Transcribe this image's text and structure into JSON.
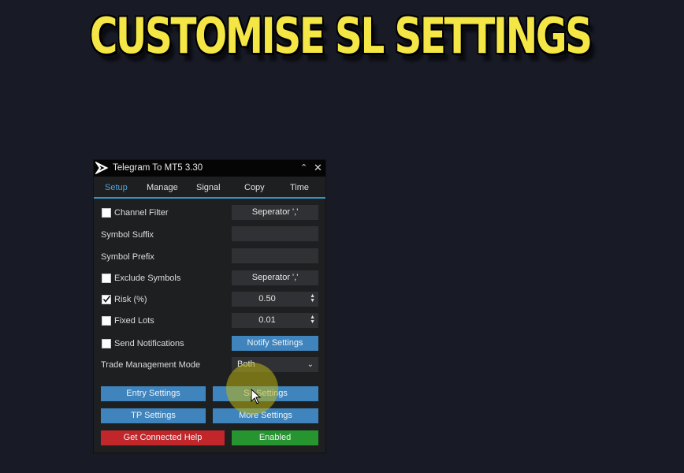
{
  "headline": "CUSTOMISE SL SETTINGS",
  "window": {
    "title": "Telegram To MT5 3.30",
    "minimize_icon": "chevron-up-icon",
    "close_icon": "close-icon"
  },
  "tabs": [
    {
      "label": "Setup",
      "active": true
    },
    {
      "label": "Manage",
      "active": false
    },
    {
      "label": "Signal",
      "active": false
    },
    {
      "label": "Copy",
      "active": false
    },
    {
      "label": "Time",
      "active": false
    }
  ],
  "settings": {
    "channel_filter": {
      "label": "Channel Filter",
      "checked": false,
      "button": "Seperator ','"
    },
    "symbol_suffix": {
      "label": "Symbol Suffix",
      "value": ""
    },
    "symbol_prefix": {
      "label": "Symbol Prefix",
      "value": ""
    },
    "exclude_symbols": {
      "label": "Exclude Symbols",
      "checked": false,
      "button": "Seperator ','"
    },
    "risk": {
      "label": "Risk (%)",
      "checked": true,
      "value": "0.50"
    },
    "fixed_lots": {
      "label": "Fixed Lots",
      "checked": false,
      "value": "0.01"
    },
    "send_notifications": {
      "label": "Send Notifications",
      "checked": false,
      "button": "Notify Settings"
    },
    "trade_management_mode": {
      "label": "Trade Management Mode",
      "value": "Both"
    }
  },
  "buttons": {
    "entry_settings": "Entry Settings",
    "sl_settings": "SL Settings",
    "tp_settings": "TP Settings",
    "more_settings": "More Settings",
    "get_connected_help": "Get Connected Help",
    "enabled": "Enabled"
  },
  "colors": {
    "accent_blue": "#3f84bd",
    "help_red": "#c0262a",
    "enabled_green": "#26952f",
    "headline_yellow": "#f4e645"
  }
}
